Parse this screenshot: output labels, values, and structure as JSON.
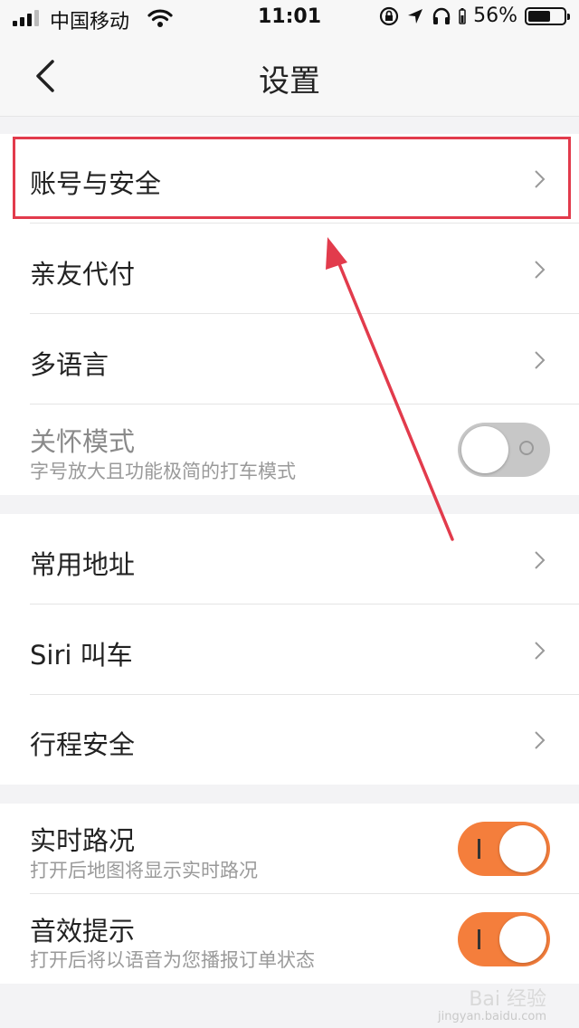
{
  "status_bar": {
    "carrier": "中国移动",
    "time": "11:01",
    "battery_text": "56%",
    "battery_level": 0.56,
    "icons": [
      "signal-icon",
      "wifi-icon",
      "orientation-lock-icon",
      "location-icon",
      "headphones-icon",
      "battery-icon"
    ]
  },
  "nav": {
    "title": "设置",
    "back_icon": "chevron-left-icon"
  },
  "group1": {
    "items": [
      {
        "label": "账号与安全"
      },
      {
        "label": "亲友代付"
      },
      {
        "label": "多语言"
      }
    ],
    "care_mode": {
      "label": "关怀模式",
      "subtitle": "字号放大且功能极简的打车模式",
      "toggle_on": false
    }
  },
  "group2": {
    "items": [
      {
        "label": "常用地址"
      },
      {
        "label": "Siri 叫车"
      },
      {
        "label": "行程安全"
      }
    ]
  },
  "group3": {
    "items": [
      {
        "label": "实时路况",
        "subtitle": "打开后地图将显示实时路况",
        "toggle_on": true
      },
      {
        "label": "音效提示",
        "subtitle": "打开后将以语音为您播报订单状态",
        "toggle_on": true
      }
    ]
  },
  "annotation": {
    "highlight_color": "#e23b4c",
    "highlighted_item": "账号与安全"
  },
  "colors": {
    "toggle_on": "#f47e3c",
    "toggle_off": "#c7c7c7",
    "background": "#f3f3f5"
  },
  "watermark": {
    "text": "Bai 经验",
    "subtext": "jingyan.baidu.com"
  }
}
